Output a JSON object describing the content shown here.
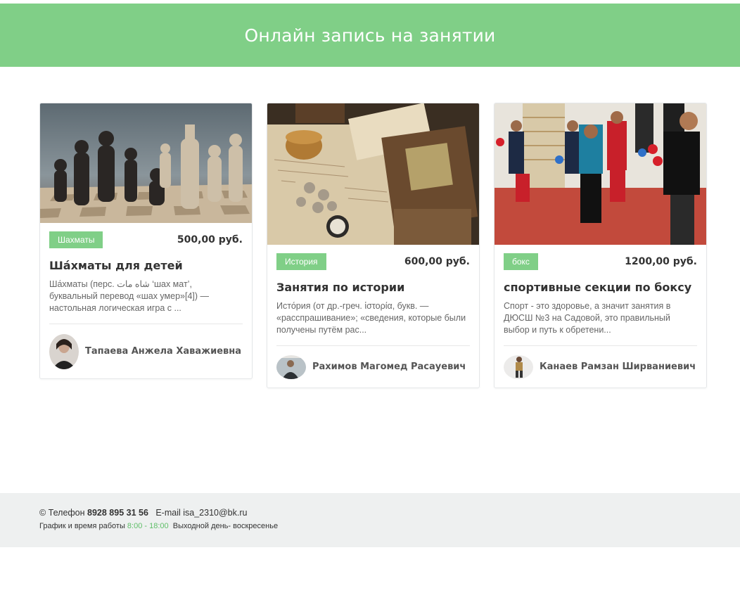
{
  "header": {
    "title": "Онлайн запись на занятии"
  },
  "cards": [
    {
      "image_icon": "chess-pieces-photo",
      "tag": "Шахматы",
      "price": "500,00 руб.",
      "title": "Ша́хматы для детей",
      "description": "Ша́хматы (перс. شاه مات ‘шах мат’, буквальный перевод «шах умер»[4]) — настольная логическая игра с ...",
      "author": "Тапаева Анжела Хаважиевна"
    },
    {
      "image_icon": "history-objects-photo",
      "tag": "История",
      "price": "600,00 руб.",
      "title": "Занятия по истории",
      "description": "Исто́рия (от др.-греч. ἱστορία, букв. — «расспрашивание»; «сведения, которые были получены путём рас...",
      "author": "Рахимов Магомед Расауевич"
    },
    {
      "image_icon": "boxing-class-photo",
      "tag": "бокс",
      "price": "1200,00 руб.",
      "title": "спортивные секции по боксу",
      "description": "Спорт - это здоровье, а значит занятия в ДЮСШ №3 на Садовой, это правильный выбор и путь к обретени...",
      "author": "Канаев Рамзан Ширваниевич"
    }
  ],
  "footer": {
    "copyright_phone_label": "© Телефон",
    "phone": "8928 895 31 56",
    "email_label": "E-mail",
    "email": "isa_2310@bk.ru",
    "hours_label": "График и время работы",
    "hours": "8:00 - 18:00",
    "day_off": "Выходной день- воскресенье"
  },
  "colors": {
    "accent": "#80cf87",
    "footer_bg": "#eef0f0"
  }
}
